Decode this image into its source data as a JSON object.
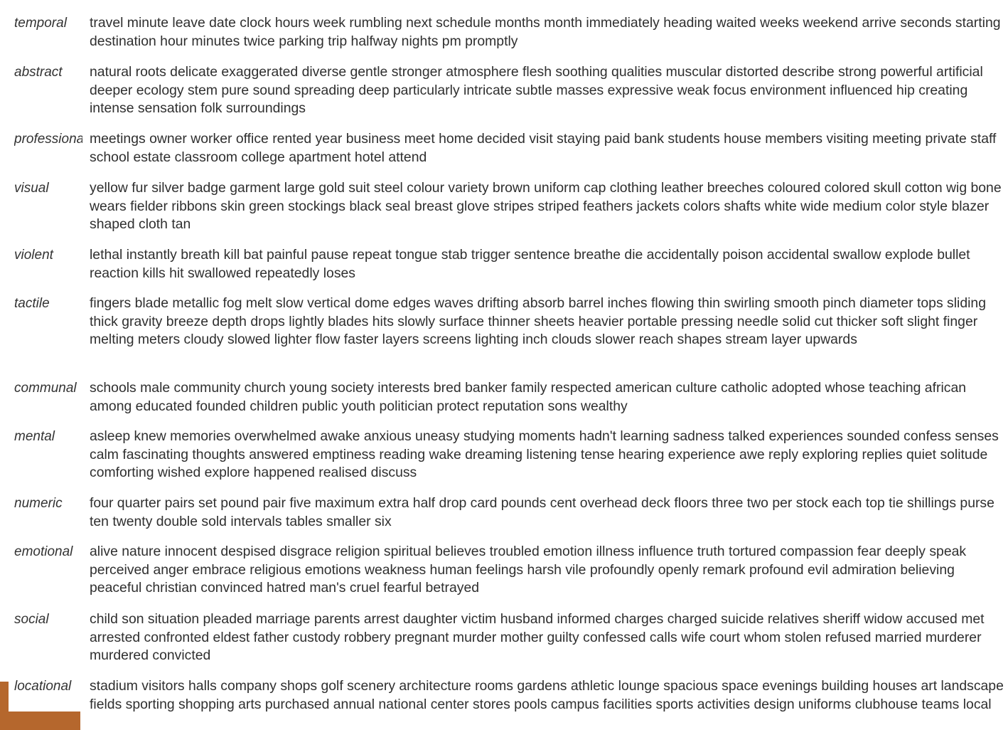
{
  "categories": [
    {
      "label": "temporal",
      "words": "travel minute leave date clock hours week rumbling next schedule months month immediately heading waited weeks weekend arrive seconds starting destination hour minutes twice parking trip halfway nights pm promptly"
    },
    {
      "label": "abstract",
      "words": "natural roots delicate exaggerated diverse gentle stronger atmosphere flesh soothing qualities muscular distorted describe strong powerful artificial deeper ecology stem pure sound spreading deep particularly intricate subtle masses expressive weak focus environment influenced hip creating intense sensation folk surroundings"
    },
    {
      "label": "professional",
      "words": "meetings owner worker office rented year business meet home decided visit staying paid bank students house members visiting meeting private staff school estate classroom college apartment hotel attend"
    },
    {
      "label": "visual",
      "words": "yellow fur silver badge garment large gold suit steel colour variety brown uniform cap clothing leather breeches coloured colored skull cotton wig bone wears fielder ribbons skin green stockings black seal breast glove stripes striped feathers jackets colors shafts white wide medium color style blazer shaped cloth tan"
    },
    {
      "label": "violent",
      "words": "lethal instantly breath kill bat painful pause repeat tongue stab trigger sentence breathe die accidentally poison accidental swallow explode bullet reaction kills hit swallowed repeatedly loses"
    },
    {
      "label": "tactile",
      "words": "fingers blade metallic fog melt slow vertical dome edges waves drifting absorb barrel inches flowing thin swirling smooth pinch diameter tops sliding thick gravity breeze depth drops lightly blades hits slowly surface thinner sheets heavier portable pressing needle solid cut thicker soft slight finger melting meters cloudy slowed lighter flow faster layers screens lighting inch clouds slower reach shapes stream layer upwards"
    },
    {
      "label": "communal",
      "words": "schools male community church young society interests bred banker family respected american culture catholic adopted whose teaching african among educated founded children public youth politician protect reputation sons wealthy"
    },
    {
      "label": "mental",
      "words": "asleep knew memories overwhelmed awake anxious uneasy studying moments hadn't learning sadness talked experiences sounded confess senses calm fascinating thoughts answered emptiness reading wake dreaming listening tense hearing experience awe reply exploring replies quiet solitude comforting wished explore happened realised discuss"
    },
    {
      "label": "numeric",
      "words": "four quarter pairs set pound pair five maximum extra half drop card pounds cent overhead deck floors three two per stock each top tie shillings purse ten twenty double sold intervals tables smaller six"
    },
    {
      "label": "emotional",
      "words": "alive nature innocent despised disgrace religion spiritual believes troubled emotion illness influence truth tortured compassion fear deeply speak perceived anger embrace religious emotions weakness human feelings harsh vile profoundly openly remark profound evil admiration believing peaceful christian convinced hatred man's cruel fearful betrayed"
    },
    {
      "label": "social",
      "words": "child son situation pleaded marriage parents arrest daughter victim husband informed charges charged suicide relatives sheriff widow accused met arrested confronted eldest father custody robbery pregnant murder mother guilty confessed calls wife court whom stolen refused married murderer murdered convicted"
    },
    {
      "label": "locational",
      "words": "stadium visitors halls company shops golf scenery architecture rooms gardens athletic lounge spacious space evenings building houses art landscape fields sporting shopping arts purchased annual national center stores pools campus facilities sports activities design uniforms clubhouse teams local"
    }
  ],
  "accent_color": "#b5672d"
}
